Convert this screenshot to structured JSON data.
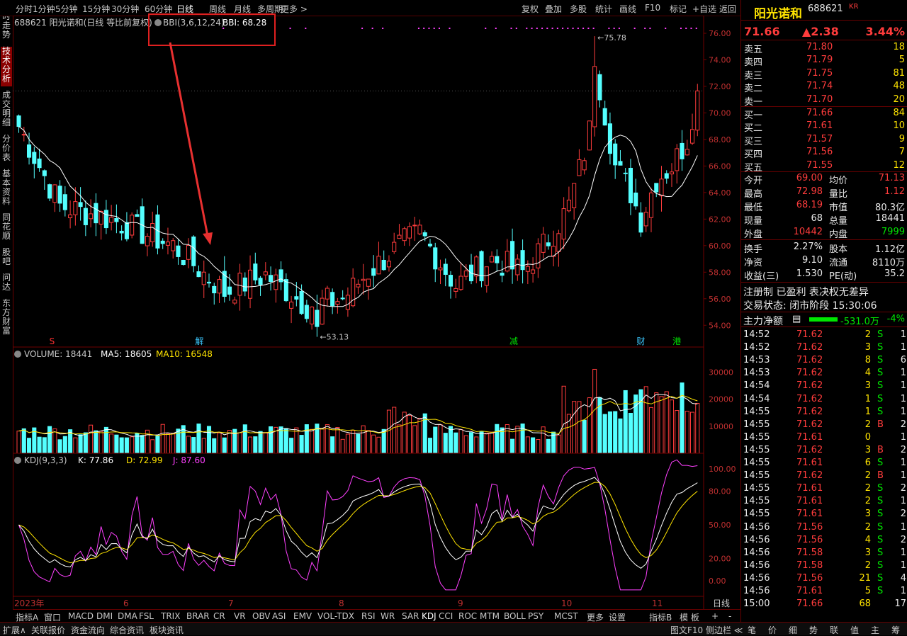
{
  "toolbar": {
    "left_items": [
      "分时",
      "1分钟",
      "5分钟",
      "15分钟",
      "30分钟",
      "60分钟",
      "日线",
      "周线",
      "月线",
      "多周期",
      "更多 >"
    ],
    "right_items": [
      "复权",
      "叠加",
      "多股",
      "统计",
      "画线",
      "F10",
      "标记",
      "+自选",
      "返回"
    ],
    "active": "日线"
  },
  "left_tabs": [
    {
      "label": "分时走势",
      "active": false
    },
    {
      "label": "技术分析",
      "active": true
    },
    {
      "label": "成交明细",
      "active": false
    },
    {
      "label": "分价表",
      "active": false
    },
    {
      "label": "基本资料",
      "active": false
    },
    {
      "label": "同花顺",
      "active": false
    },
    {
      "label": "股吧",
      "active": false
    },
    {
      "label": "问达",
      "active": false
    },
    {
      "label": "东方财富",
      "active": false
    }
  ],
  "main_chart": {
    "header": "688621 阳光诺和(日线 等比前复权)",
    "indicator_label": "BBI(3,6,12,24)",
    "indicator_value": "BBI: 68.28",
    "high_label": "75.78",
    "low_label": "53.13",
    "price_ticks": [
      "76.00",
      "74.00",
      "72.00",
      "70.00",
      "68.00",
      "66.00",
      "64.00",
      "62.00",
      "60.00",
      "58.00",
      "56.00",
      "54.00"
    ],
    "event_marks": [
      {
        "text": "S",
        "color": "#ff3030",
        "pos": 0.053
      },
      {
        "text": "解",
        "color": "#3cc8ff",
        "pos": 0.264
      },
      {
        "text": "减",
        "color": "#00e000",
        "pos": 0.719
      },
      {
        "text": "财",
        "color": "#3cc8ff",
        "pos": 0.903
      },
      {
        "text": "港",
        "color": "#00e000",
        "pos": 0.955
      }
    ]
  },
  "volume_chart": {
    "label": "VOLUME: 18441",
    "ma5": "MA5: 18605",
    "ma10": "MA10: 16548",
    "ticks": [
      "30000",
      "20000",
      "10000"
    ]
  },
  "kdj_chart": {
    "label": "KDJ(9,3,3)",
    "k": "K: 77.86",
    "d": "D: 72.99",
    "j": "J: 87.60",
    "ticks": [
      "100.00",
      "80.00",
      "50.00",
      "20.00",
      "0.00"
    ]
  },
  "date_axis": [
    "2023年",
    "6",
    "7",
    "8",
    "9",
    "10",
    "11",
    "日线"
  ],
  "indicator_tabs": [
    "指标A",
    "窗口",
    "MACD",
    "DMI",
    "DMA",
    "FSL",
    "TRIX",
    "BRAR",
    "CR",
    "VR",
    "OBV",
    "ASI",
    "EMV",
    "VOL-TDX",
    "RSI",
    "WR",
    "SAR",
    "KDJ",
    "CCI",
    "ROC",
    "MTM",
    "BOLL",
    "PSY",
    "MCST",
    "更多",
    "设置",
    "指标B",
    "模 板",
    "+",
    "-"
  ],
  "bottom_tabs": [
    "扩展∧",
    "关联报价",
    "资金流向",
    "综合资讯",
    "板块资讯"
  ],
  "bottom_right": "图文F10 侧边栏 ≪",
  "right_bottom_tabs": [
    "笔",
    "价",
    "细",
    "势",
    "联",
    "值",
    "主",
    "筹"
  ],
  "quote": {
    "name": "阳光诺和",
    "code": "688621",
    "badge": "KR",
    "price": "71.66",
    "change": "▲2.38",
    "pct": "3.44%",
    "asks": [
      {
        "label": "卖五",
        "price": "71.80",
        "vol": "18"
      },
      {
        "label": "卖四",
        "price": "71.79",
        "vol": "5"
      },
      {
        "label": "卖三",
        "price": "71.75",
        "vol": "81"
      },
      {
        "label": "卖二",
        "price": "71.74",
        "vol": "48"
      },
      {
        "label": "卖一",
        "price": "71.70",
        "vol": "20"
      }
    ],
    "bids": [
      {
        "label": "买一",
        "price": "71.66",
        "vol": "84"
      },
      {
        "label": "买二",
        "price": "71.61",
        "vol": "10"
      },
      {
        "label": "买三",
        "price": "71.57",
        "vol": "9"
      },
      {
        "label": "买四",
        "price": "71.56",
        "vol": "7"
      },
      {
        "label": "买五",
        "price": "71.55",
        "vol": "12"
      }
    ],
    "stats": [
      {
        "l1": "今开",
        "v1": "69.00",
        "c1": "red",
        "l2": "均价",
        "v2": "71.13",
        "c2": "red"
      },
      {
        "l1": "最高",
        "v1": "72.98",
        "c1": "red",
        "l2": "量比",
        "v2": "1.12",
        "c2": "red"
      },
      {
        "l1": "最低",
        "v1": "68.19",
        "c1": "red",
        "l2": "市值",
        "v2": "80.3亿",
        "c2": "wht"
      },
      {
        "l1": "现量",
        "v1": "68",
        "c1": "wht",
        "l2": "总量",
        "v2": "18441",
        "c2": "wht"
      },
      {
        "l1": "外盘",
        "v1": "10442",
        "c1": "red",
        "l2": "内盘",
        "v2": "7999",
        "c2": "grn"
      }
    ],
    "stats2": [
      {
        "l1": "换手",
        "v1": "2.27%",
        "l2": "股本",
        "v2": "1.12亿"
      },
      {
        "l1": "净资",
        "v1": "9.10",
        "l2": "流通",
        "v2": "8110万"
      },
      {
        "l1": "收益(三)",
        "v1": "1.530",
        "l2": "PE(动)",
        "v2": "35.2"
      }
    ],
    "tag_line": "注册制 已盈利 表决权无差异",
    "trade_status": "交易状态: 闭市阶段 15:30:06",
    "main_flow_label": "主力净额",
    "main_flow_value": "-531.0万",
    "main_flow_pct": "-4%",
    "ticks": [
      {
        "t": "14:52",
        "p": "71.62",
        "v": "2",
        "s": "S",
        "n": "1"
      },
      {
        "t": "14:52",
        "p": "71.62",
        "v": "3",
        "s": "S",
        "n": "1"
      },
      {
        "t": "14:53",
        "p": "71.62",
        "v": "8",
        "s": "S",
        "n": "6"
      },
      {
        "t": "14:53",
        "p": "71.62",
        "v": "4",
        "s": "S",
        "n": "1"
      },
      {
        "t": "14:54",
        "p": "71.62",
        "v": "3",
        "s": "S",
        "n": "1"
      },
      {
        "t": "14:54",
        "p": "71.62",
        "v": "1",
        "s": "S",
        "n": "1"
      },
      {
        "t": "14:55",
        "p": "71.62",
        "v": "1",
        "s": "S",
        "n": "1"
      },
      {
        "t": "14:55",
        "p": "71.62",
        "v": "2",
        "s": "B",
        "n": "2"
      },
      {
        "t": "14:55",
        "p": "71.61",
        "v": "0",
        "s": "",
        "n": "1"
      },
      {
        "t": "14:55",
        "p": "71.62",
        "v": "3",
        "s": "B",
        "n": "2"
      },
      {
        "t": "14:55",
        "p": "71.61",
        "v": "6",
        "s": "S",
        "n": "1"
      },
      {
        "t": "14:55",
        "p": "71.62",
        "v": "2",
        "s": "B",
        "n": "1"
      },
      {
        "t": "14:55",
        "p": "71.61",
        "v": "2",
        "s": "S",
        "n": "2"
      },
      {
        "t": "14:55",
        "p": "71.61",
        "v": "2",
        "s": "S",
        "n": "1"
      },
      {
        "t": "14:55",
        "p": "71.61",
        "v": "3",
        "s": "S",
        "n": "2"
      },
      {
        "t": "14:56",
        "p": "71.56",
        "v": "2",
        "s": "S",
        "n": "1"
      },
      {
        "t": "14:56",
        "p": "71.56",
        "v": "4",
        "s": "S",
        "n": "2"
      },
      {
        "t": "14:56",
        "p": "71.58",
        "v": "3",
        "s": "S",
        "n": "1"
      },
      {
        "t": "14:56",
        "p": "71.58",
        "v": "2",
        "s": "S",
        "n": "1"
      },
      {
        "t": "14:56",
        "p": "71.56",
        "v": "21",
        "s": "S",
        "n": "4"
      },
      {
        "t": "14:56",
        "p": "71.61",
        "v": "5",
        "s": "S",
        "n": "1"
      },
      {
        "t": "15:00",
        "p": "71.66",
        "v": "68",
        "s": "",
        "n": "17"
      }
    ]
  },
  "colors": {
    "up": "#ff3c3c",
    "down": "#54ffff",
    "bbi": "#ffffff",
    "ma5": "#ffffff",
    "ma10": "#ffe400",
    "k": "#ffffff",
    "d": "#ffe400",
    "j": "#ff40ff",
    "grid": "#700000"
  }
}
